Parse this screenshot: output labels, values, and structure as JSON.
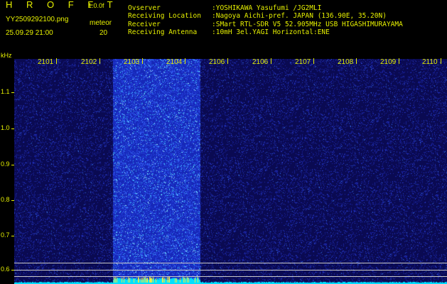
{
  "header": {
    "brand": "H R O F F T",
    "version": "1.0.0f",
    "filename": "YY2509292100.png",
    "mode": "meteor",
    "timestamp": "25.09.29 21:00",
    "meteor_count": "20"
  },
  "station": {
    "observer_label": "Ovserver",
    "observer_value": ":YOSHIKAWA Yasufumi /JG2MLI",
    "location_label": "Receiving Location",
    "location_value": ":Nagoya Aichi-pref. JAPAN (136.90E, 35.20N)",
    "receiver_label": "Receiver",
    "receiver_value": ":SMart RTL-SDR V5 52.905MHz USB HIGASHIMURAYAMA",
    "antenna_label": "Receiving Antenna",
    "antenna_value": ":10mH 3el.YAGI Horizontal:ENE"
  },
  "axis": {
    "unit": "kHz",
    "y_labels": [
      "1.1",
      "1.0",
      "0.9",
      "0.8",
      "0.7",
      "0.6"
    ],
    "time_labels": [
      "2101",
      "2102",
      "2103",
      "2104",
      "2106",
      "2106",
      "2107",
      "2108",
      "2109",
      "2110"
    ]
  },
  "colors": {
    "text": "#e6f000",
    "background": "#000000",
    "noise_floor": "#0a0a52",
    "signal_band": "#1a2ad8",
    "baseline": "#00e0ff"
  }
}
